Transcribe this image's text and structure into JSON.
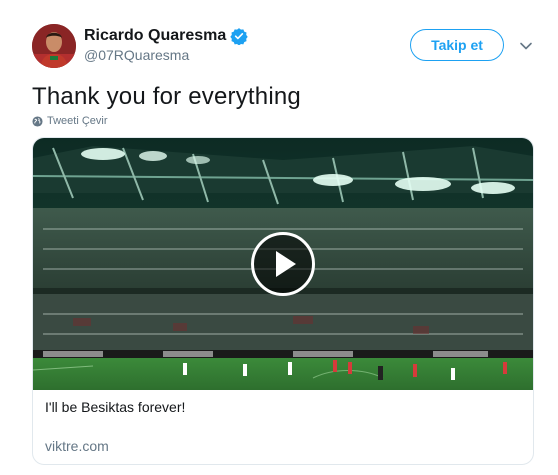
{
  "author": {
    "display_name": "Ricardo Quaresma",
    "handle": "@07RQuaresma",
    "verified": true
  },
  "header": {
    "follow_label": "Takip et",
    "caret_icon": "chevron-down-icon"
  },
  "tweet": {
    "text": "Thank you for everything",
    "translate_label": "Tweeti Çevir"
  },
  "card": {
    "title": "I'll be Besiktas forever!",
    "domain": "viktre.com",
    "media_type": "video"
  },
  "colors": {
    "accent": "#1da1f2",
    "secondary_text": "#657786",
    "border": "#e1e8ed"
  }
}
